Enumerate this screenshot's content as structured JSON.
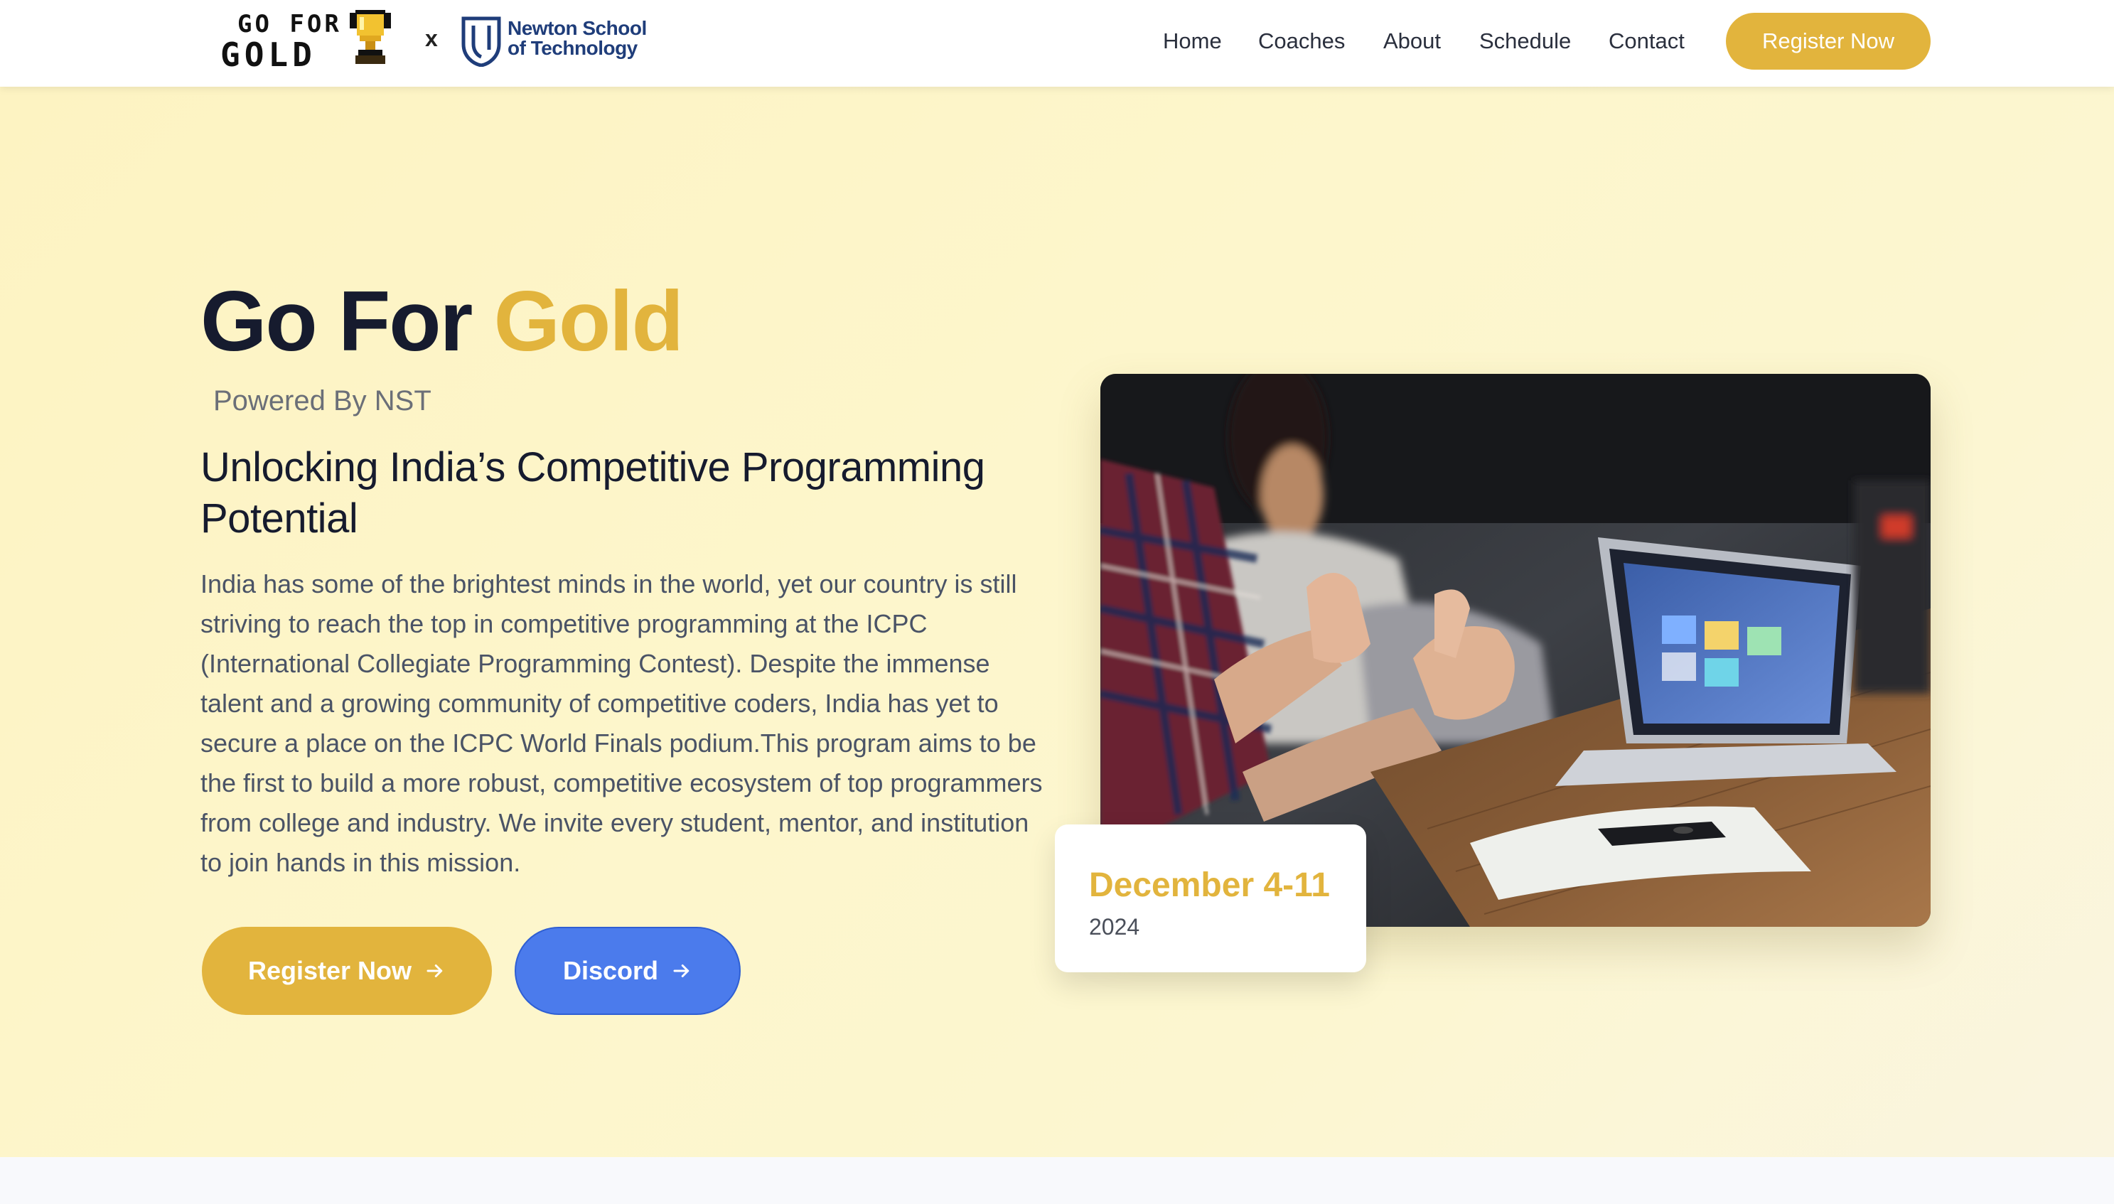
{
  "header": {
    "logo_text_top": "GO FOR",
    "logo_text_bottom": "GOLD",
    "separator": "x",
    "partner_line1": "Newton School",
    "partner_line2": "of Technology",
    "nav": [
      {
        "label": "Home"
      },
      {
        "label": "Coaches"
      },
      {
        "label": "About"
      },
      {
        "label": "Schedule"
      },
      {
        "label": "Contact"
      }
    ],
    "cta_label": "Register Now"
  },
  "hero": {
    "title_main": "Go For",
    "title_accent": "Gold",
    "powered_by": "Powered By NST",
    "subtitle": "Unlocking India’s Competitive Programming Potential",
    "description": "India has some of the brightest minds in the world, yet our country is still striving to reach the top in competitive programming at the ICPC (International Collegiate Programming Contest). Despite the immense talent and a growing community of competitive coders, India has yet to secure a place on the ICPC World Finals podium.This program aims to be the first to build a more robust, competitive ecosystem of top programmers from college and industry. We invite every student, mentor, and institution to join hands in this mission.",
    "register_label": "Register Now",
    "discord_label": "Discord",
    "date_range": "December 4-11",
    "date_year": "2024"
  },
  "colors": {
    "accent_gold": "#e2b43d",
    "discord_blue": "#4b7bec",
    "heading_dark": "#161b2e",
    "hero_bg": "#fdf3c2"
  },
  "icons": {
    "arrow": "arrow-right-icon",
    "trophy": "trophy-icon",
    "shield": "shield-logo-icon"
  }
}
